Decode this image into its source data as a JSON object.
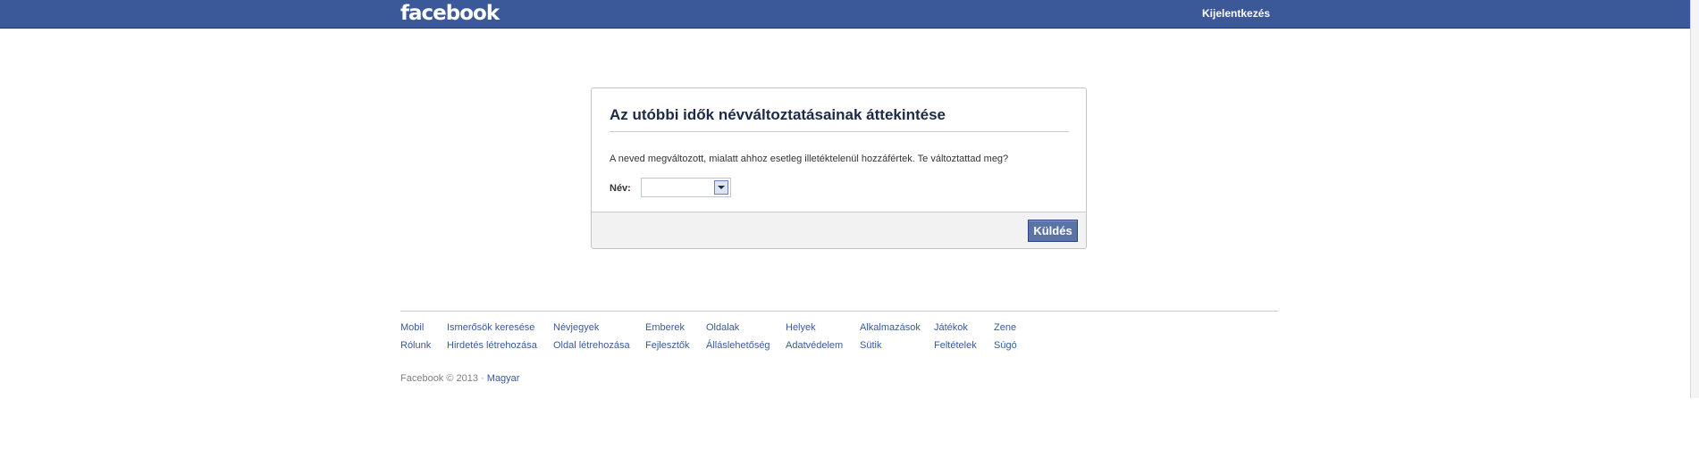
{
  "header": {
    "logo_text": "facebook",
    "logout_label": "Kijelentkezés"
  },
  "dialog": {
    "title": "Az utóbbi idők névváltoztatásainak áttekintése",
    "message": "A neved megváltozott, mialatt ahhoz esetleg illetéktelenül hozzáfértek. Te változtattad meg?",
    "name_label": "Név:",
    "name_select_value": "",
    "submit_label": "Küldés"
  },
  "footer": {
    "row1": [
      "Mobil",
      "Ismerősök keresése",
      "Névjegyek",
      "Emberek",
      "Oldalak",
      "Helyek",
      "Alkalmazások",
      "Játékok",
      "Zene"
    ],
    "row2": [
      "Rólunk",
      "Hirdetés létrehozása",
      "Oldal létrehozása",
      "Fejlesztők",
      "Álláslehetőség",
      "Adatvédelem",
      "Sütik",
      "Feltételek",
      "Súgó"
    ],
    "copyright": "Facebook © 2013 ·",
    "language": "Magyar"
  },
  "colors": {
    "brand_blue": "#3b5998",
    "button_blue": "#5b74a8",
    "footer_gray": "#f2f2f2"
  }
}
